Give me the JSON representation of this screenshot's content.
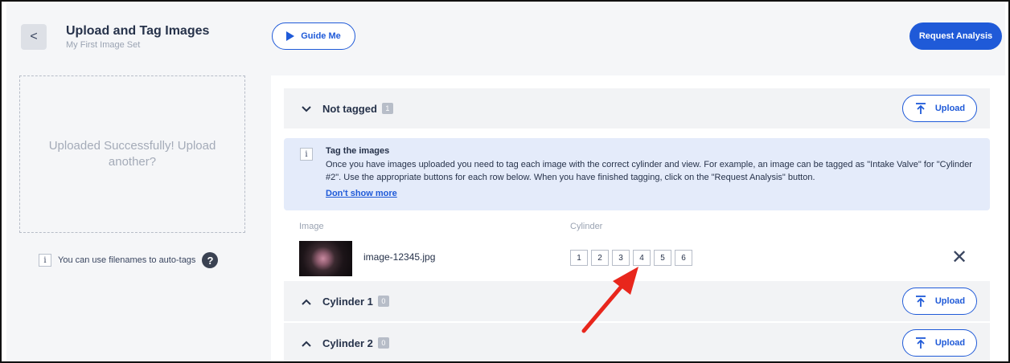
{
  "header": {
    "title": "Upload and Tag Images",
    "subtitle": "My First Image Set",
    "back_glyph": "<",
    "guide_label": "Guide Me",
    "request_label": "Request Analysis"
  },
  "left_panel": {
    "dropzone_text": "Uploaded Successfully! Upload another?",
    "autotag_text": "You can use filenames to auto-tags",
    "help_glyph": "?"
  },
  "sections": {
    "not_tagged": {
      "label": "Not tagged",
      "count": "1",
      "upload_label": "Upload",
      "chevron": "⌄"
    },
    "cylinder1": {
      "label": "Cylinder 1",
      "count": "0",
      "upload_label": "Upload",
      "chevron": "⌃"
    },
    "cylinder2": {
      "label": "Cylinder 2",
      "count": "0",
      "upload_label": "Upload",
      "chevron": "⌃"
    }
  },
  "notice": {
    "icon": "i",
    "title": "Tag the images",
    "body": "Once you have images uploaded you need to tag each image with the correct cylinder and view. For example, an image can be tagged as \"Intake Valve\" for \"Cylinder #2\". Use the appropriate buttons for each row below. When you have finished tagging, click on the \"Request Analysis\" button.",
    "link": "Don't show more"
  },
  "table": {
    "col_image": "Image",
    "col_cylinder": "Cylinder",
    "rows": [
      {
        "filename": "image-12345.jpg",
        "cylinders": [
          "1",
          "2",
          "3",
          "4",
          "5",
          "6"
        ],
        "remove": "✕"
      }
    ]
  },
  "colors": {
    "accent": "#1f5ad8",
    "annotation_arrow": "#e8261c",
    "notice_bg": "#e4ebfa"
  }
}
